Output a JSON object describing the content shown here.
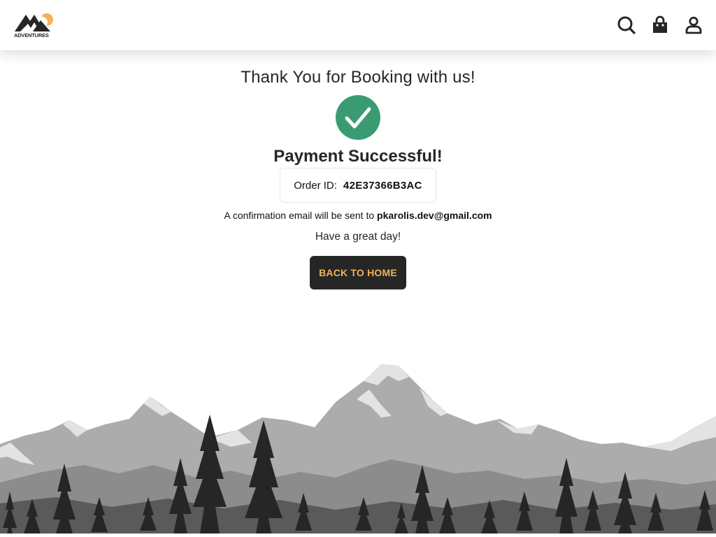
{
  "header": {
    "logo_text": "ADVENTURES",
    "icons": [
      "search-icon",
      "shopping-bag-icon",
      "user-icon"
    ]
  },
  "main": {
    "title": "Thank You for Booking with us!",
    "status_icon": "check-circle-icon",
    "success_message": "Payment Successful!",
    "order_label": "Order ID:",
    "order_id": "42E37366B3AC",
    "confirmation_text": "A confirmation email will be sent to",
    "email": "pkarolis.dev@gmail.com",
    "greeting": "Have a great day!",
    "back_button": "BACK TO HOME"
  },
  "colors": {
    "accent": "#f2b35a",
    "success": "#3a9b72",
    "dark": "#262626"
  }
}
